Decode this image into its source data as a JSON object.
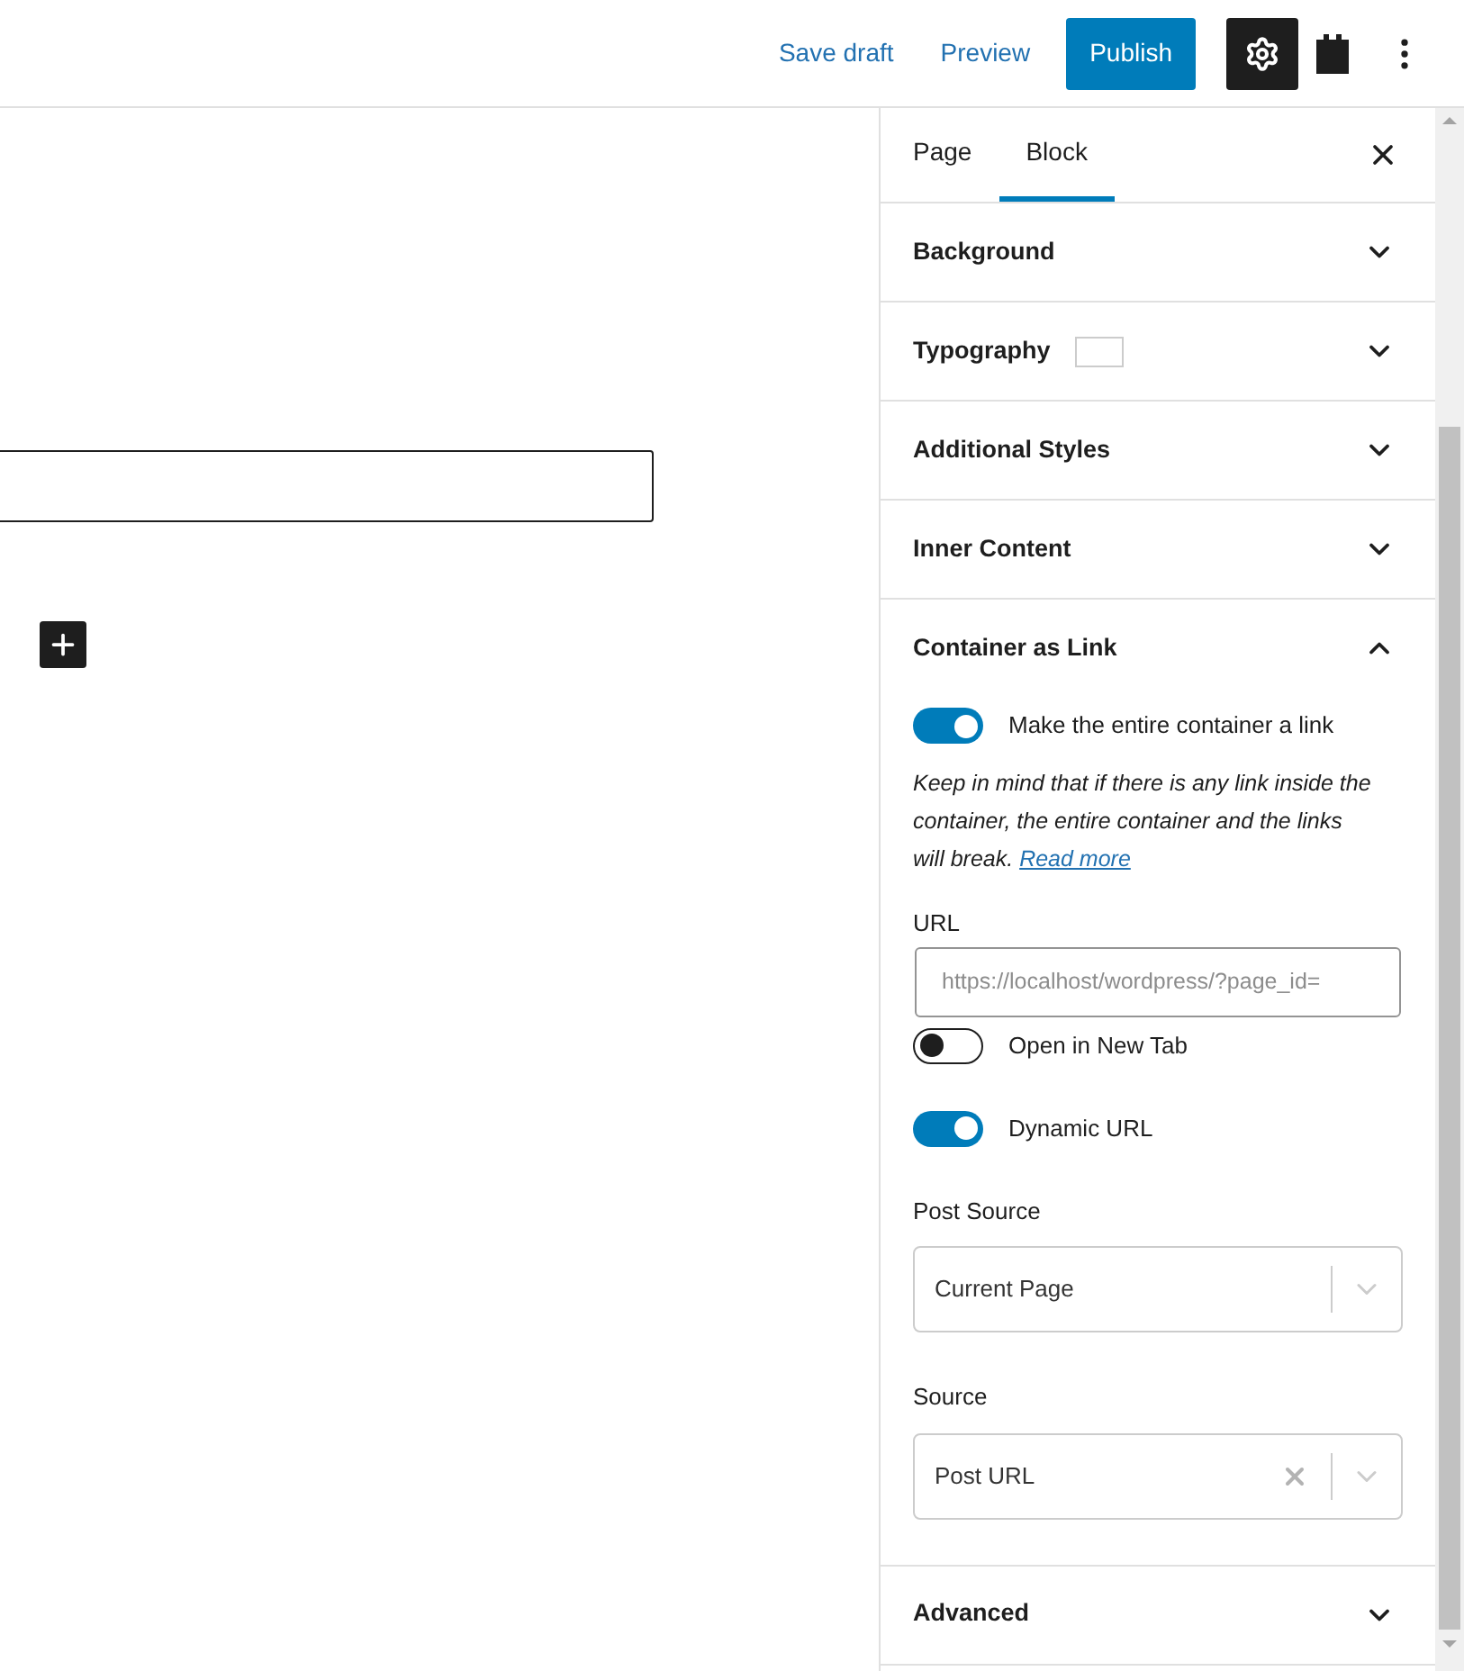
{
  "header": {
    "save_draft": "Save draft",
    "preview": "Preview",
    "publish": "Publish",
    "settings_active": true
  },
  "sidebar": {
    "tabs": [
      {
        "label": "Page",
        "selected": false
      },
      {
        "label": "Block",
        "selected": true
      }
    ],
    "panels": [
      {
        "title": "Background",
        "expanded": false
      },
      {
        "title": "Typography",
        "expanded": false,
        "swatch": true
      },
      {
        "title": "Additional Styles",
        "expanded": false
      },
      {
        "title": "Inner Content",
        "expanded": false
      },
      {
        "title": "Container as Link",
        "expanded": true,
        "controls": [
          {
            "kind": "toggle",
            "label": "Make the entire container a link",
            "on": true
          },
          {
            "kind": "note",
            "text": "Keep in mind that if there is any link inside the container, the entire container and the links will break.",
            "link": "Read more"
          },
          {
            "kind": "text_field",
            "label": "URL",
            "placeholder": "https://localhost/wordpress/?page_id="
          },
          {
            "kind": "toggle",
            "label": "Open in New Tab",
            "on": false
          },
          {
            "kind": "toggle",
            "label": "Dynamic URL",
            "on": true
          },
          {
            "kind": "select",
            "label": "Post Source",
            "value": "Current Page",
            "clearable": false
          },
          {
            "kind": "select",
            "label": "Source",
            "value": "Post URL",
            "clearable": true
          }
        ]
      },
      {
        "title": "Advanced",
        "expanded": false
      }
    ]
  }
}
